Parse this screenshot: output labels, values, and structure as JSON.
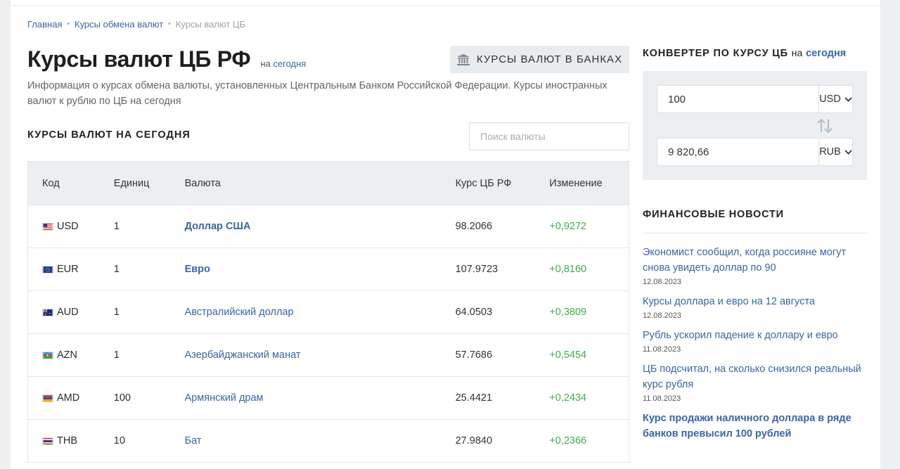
{
  "breadcrumb": {
    "home": "Главная",
    "exchange": "Курсы обмена валют",
    "current": "Курсы валют ЦБ"
  },
  "header": {
    "title": "Курсы валют ЦБ РФ",
    "suffix_prefix": "на",
    "suffix_link": "сегодня",
    "banks_button": "КУРСЫ ВАЛЮТ В БАНКАХ",
    "description": "Информация о курсах обмена валюты, установленных Центральным Банком Российской Федерации. Курсы иностранных валют к рублю по ЦБ на сегодня"
  },
  "rates": {
    "section_title": "КУРСЫ ВАЛЮТ НА СЕГОДНЯ",
    "search_placeholder": "Поиск валюты",
    "columns": {
      "code": "Код",
      "units": "Единиц",
      "name": "Валюта",
      "rate": "Курс ЦБ РФ",
      "change": "Изменение"
    },
    "rows": [
      {
        "code": "USD",
        "units": "1",
        "name": "Доллар США",
        "rate": "98.2066",
        "change": "+0,9272"
      },
      {
        "code": "EUR",
        "units": "1",
        "name": "Евро",
        "rate": "107.9723",
        "change": "+0,8160"
      },
      {
        "code": "AUD",
        "units": "1",
        "name": "Австралийский доллар",
        "rate": "64.0503",
        "change": "+0,3809"
      },
      {
        "code": "AZN",
        "units": "1",
        "name": "Азербайджанский манат",
        "rate": "57.7686",
        "change": "+0,5454"
      },
      {
        "code": "AMD",
        "units": "100",
        "name": "Армянский драм",
        "rate": "25.4421",
        "change": "+0,2434"
      },
      {
        "code": "THB",
        "units": "10",
        "name": "Бат",
        "rate": "27.9840",
        "change": "+0,2366"
      }
    ]
  },
  "converter": {
    "title": "КОНВЕРТЕР ПО КУРСУ ЦБ",
    "title_prefix": "на",
    "title_link": "сегодня",
    "from_amount": "100",
    "from_currency": "USD",
    "to_amount": "9 820,66",
    "to_currency": "RUB"
  },
  "news": {
    "title": "ФИНАНСОВЫЕ НОВОСТИ",
    "items": [
      {
        "headline": "Экономист сообщил, когда россияне могут снова увидеть доллар по 90",
        "date": "12.08.2023"
      },
      {
        "headline": "Курсы доллара и евро на 12 августа",
        "date": "12.08.2023"
      },
      {
        "headline": "Рубль ускорил падение к доллару и евро",
        "date": "11.08.2023"
      },
      {
        "headline": "ЦБ подсчитал, на сколько снизился реальный курс рубля",
        "date": "11.08.2023"
      },
      {
        "headline": "Курс продажи наличного доллара в ряде банков превысил 100 рублей",
        "date": ""
      }
    ]
  },
  "colors": {
    "link": "#3a64a6",
    "positive": "#3fae49",
    "header_bg": "#eceff2"
  }
}
